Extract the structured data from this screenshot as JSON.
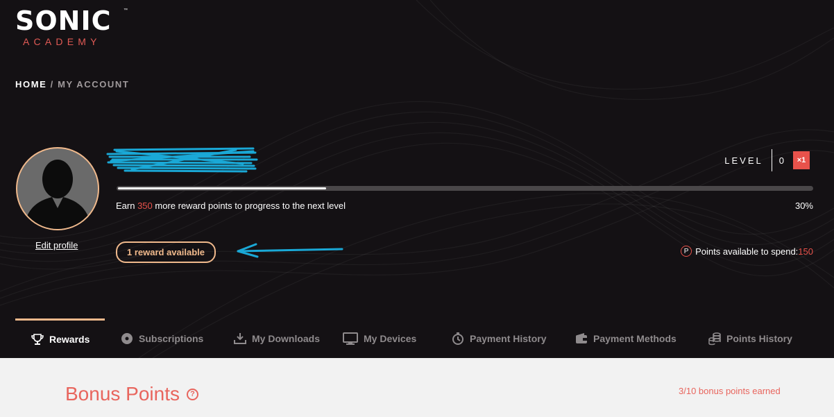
{
  "brand": {
    "name": "SONIC",
    "sub": "ACADEMY",
    "tm": "™"
  },
  "breadcrumb": {
    "home": "HOME",
    "sep": "/",
    "current": "MY ACCOUNT"
  },
  "profile": {
    "edit_label": "Edit profile"
  },
  "level": {
    "label": "LEVEL",
    "value": "0",
    "multiplier": "×1"
  },
  "progress": {
    "fraction": 0.3,
    "text_before": "Earn ",
    "points_needed": "350",
    "text_after": " more reward points to progress to the next level",
    "percent_label": "30%"
  },
  "reward_button": {
    "label": "1 reward available"
  },
  "points": {
    "icon_letter": "P",
    "label": "Points available to spend: ",
    "value": "150"
  },
  "tabs": [
    {
      "label": "Rewards",
      "icon": "trophy-icon",
      "active": true
    },
    {
      "label": "Subscriptions",
      "icon": "disc-icon"
    },
    {
      "label": "My Downloads",
      "icon": "download-icon"
    },
    {
      "label": "My Devices",
      "icon": "monitor-icon"
    },
    {
      "label": "Payment History",
      "icon": "stopwatch-icon"
    },
    {
      "label": "Payment Methods",
      "icon": "wallet-icon"
    },
    {
      "label": "Points History",
      "icon": "coins-icon"
    }
  ],
  "bonus": {
    "title": "Bonus Points",
    "help": "?",
    "earned": "3/10 bonus points earned"
  },
  "colors": {
    "accent": "#e8524b",
    "ring": "#f0b98c",
    "hero_bg": "#141114",
    "annotation": "#1aa8d6"
  }
}
